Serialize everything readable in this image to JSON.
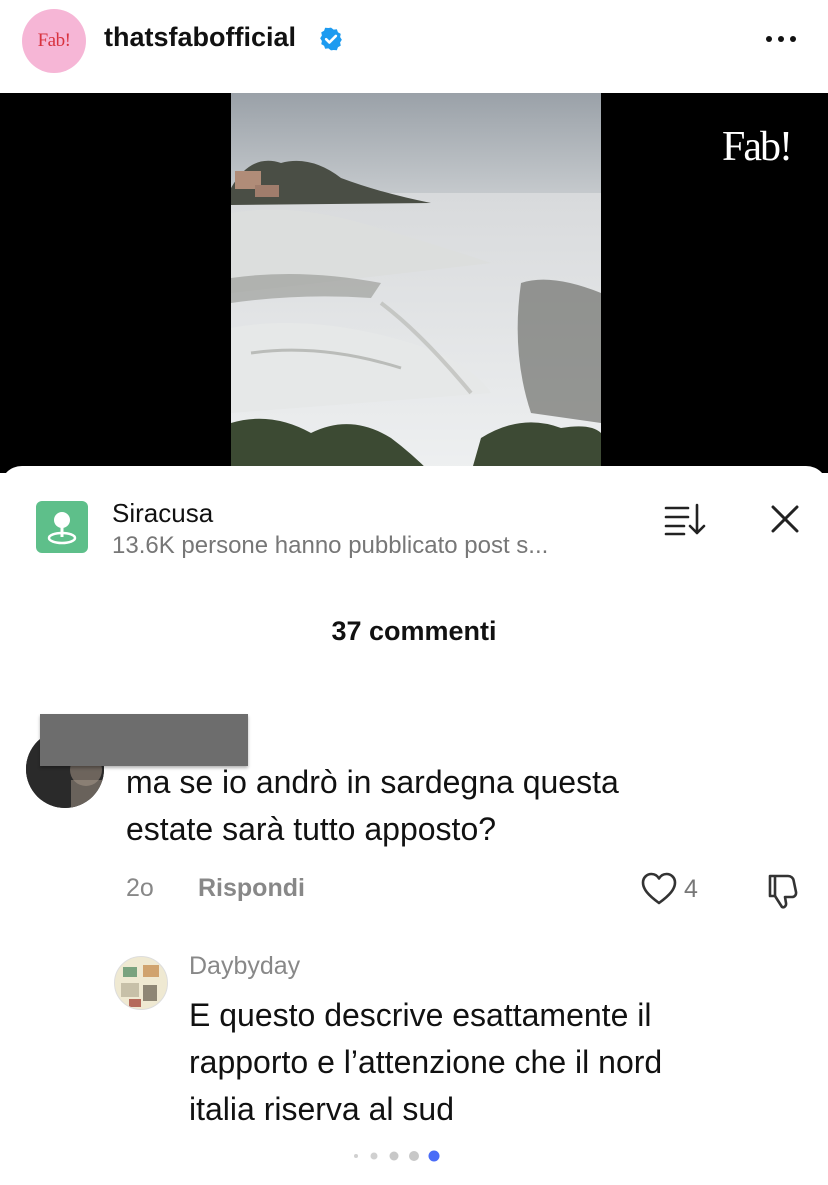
{
  "header": {
    "avatar_text": "Fab!",
    "account_name": "thatsfabofficial",
    "verified": true
  },
  "video": {
    "watermark": "Fab!"
  },
  "sheet": {
    "location_title": "Siracusa",
    "location_subtitle": "13.6K persone hanno pubblicato post s...",
    "comments_count": "37 commenti"
  },
  "comments": [
    {
      "text_line1": "ma se io andrò in sardegna questa",
      "text_line2": "estate sarà tutto apposto?",
      "time": "2o",
      "reply_label": "Rispondi",
      "likes": "4"
    }
  ],
  "reply": {
    "username": "Daybyday",
    "text_line1": "E questo descrive esattamente il",
    "text_line2": "rapporto e l’attenzione che il nord",
    "text_line3": "italia riserva al sud"
  },
  "pagination": {
    "total": 5,
    "active": 5
  },
  "colors": {
    "location_icon_bg": "#5ebf8a",
    "avatar_bg": "#f6b6d6",
    "verified_blue": "#1d9bf0",
    "active_dot": "#4a6cf7"
  }
}
